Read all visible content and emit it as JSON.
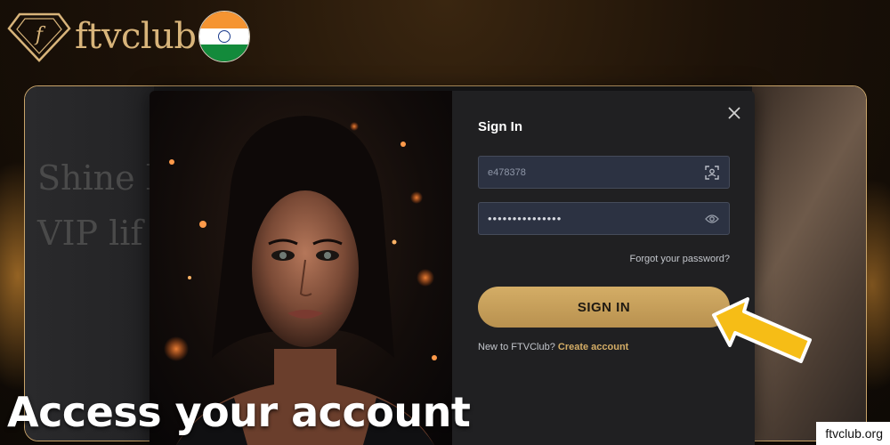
{
  "header": {
    "logo_text": "ftvclub",
    "logo_mark_letters": "f",
    "flag": "india-flag"
  },
  "background_page": {
    "headline": "Shine l\nVIP lif"
  },
  "modal": {
    "title": "Sign In",
    "close_icon": "close-icon",
    "username": {
      "value": "e478378",
      "icon": "face-scan-icon"
    },
    "password": {
      "value": "•••••••••••••••",
      "icon": "eye-icon"
    },
    "forgot_password": "Forgot your password?",
    "sign_in_button": "SIGN IN",
    "new_user_text": "New to FTVClub?",
    "create_account_link": "Create account"
  },
  "caption": "Access your account",
  "watermark": "ftvclub.org",
  "colors": {
    "gold": "#d4ad66",
    "arrow": "#f6bd16",
    "field_bg": "#2c3242",
    "modal_bg": "#202022"
  }
}
